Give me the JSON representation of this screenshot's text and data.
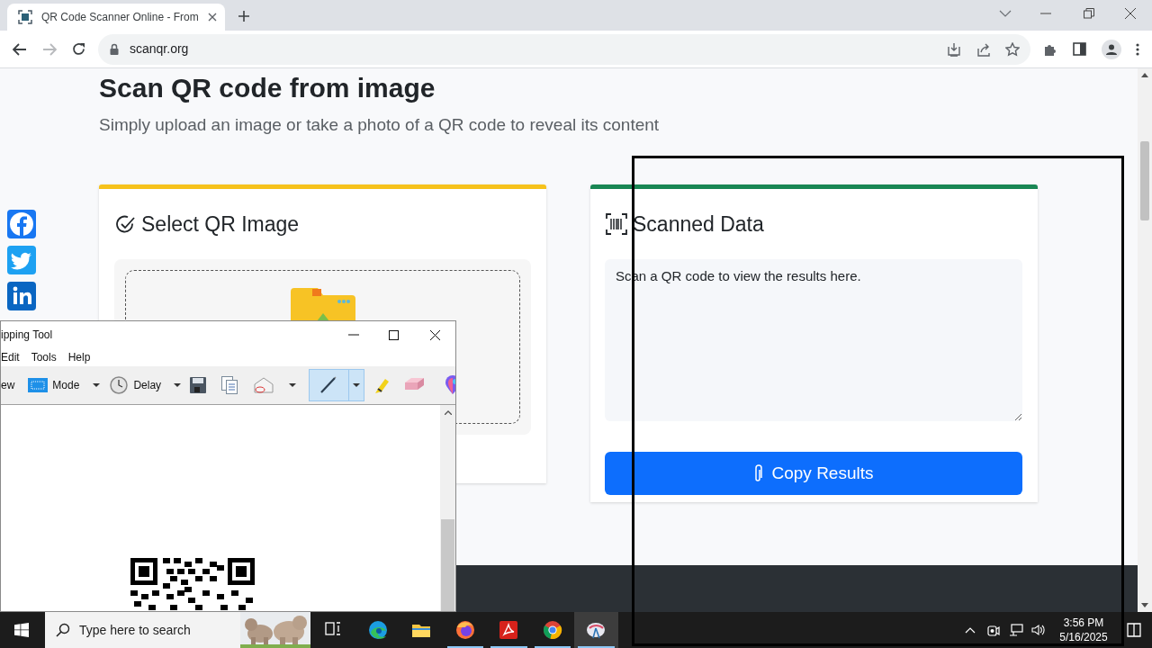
{
  "browser": {
    "tab": {
      "title": "QR Code Scanner Online - From"
    },
    "url": "scanqr.org"
  },
  "page": {
    "heading": "Scan QR code from image",
    "subtitle": "Simply upload an image or take a photo of a QR code to reveal its content",
    "share_buttons": [
      {
        "kind": "facebook"
      },
      {
        "kind": "twitter"
      },
      {
        "kind": "linkedin"
      }
    ],
    "select_card": {
      "title": "Select QR Image"
    },
    "scanned_card": {
      "title": "Scanned Data",
      "placeholder": "Scan a QR code to view the results here.",
      "button": "Copy Results"
    }
  },
  "snipping_tool": {
    "title": "ipping Tool",
    "menu": [
      "Edit",
      "Tools",
      "Help"
    ],
    "new_label": "ew",
    "mode_label": "Mode",
    "delay_label": "Delay",
    "tools": [
      {
        "kind": "pen",
        "selected": true
      },
      {
        "kind": "highlighter",
        "selected": false
      },
      {
        "kind": "eraser",
        "selected": false
      }
    ]
  },
  "taskbar": {
    "search_placeholder": "Type here to search",
    "apps": [
      {
        "kind": "task-view",
        "selected": false,
        "running": false
      },
      {
        "kind": "edge",
        "selected": false,
        "running": false
      },
      {
        "kind": "explorer",
        "selected": false,
        "running": false
      },
      {
        "kind": "firefox",
        "selected": false,
        "running": true
      },
      {
        "kind": "acrobat",
        "selected": false,
        "running": true
      },
      {
        "kind": "chrome",
        "selected": false,
        "running": true
      },
      {
        "kind": "snipping",
        "selected": true,
        "running": true
      }
    ],
    "time": "3:56 PM",
    "date": "5/16/2025"
  }
}
